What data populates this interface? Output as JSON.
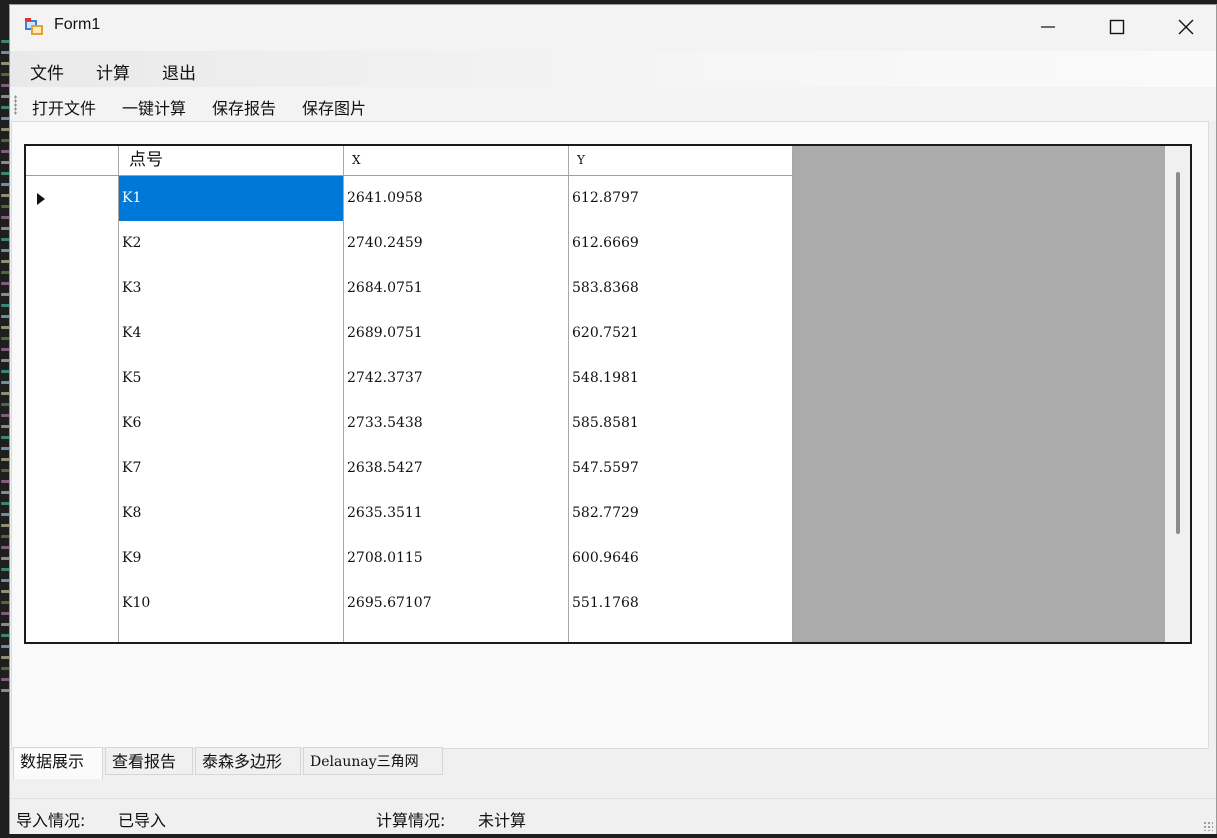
{
  "window": {
    "title": "Form1"
  },
  "menu": {
    "items": [
      "文件",
      "计算",
      "退出"
    ]
  },
  "toolbar": {
    "items": [
      "打开文件",
      "一键计算",
      "保存报告",
      "保存图片"
    ]
  },
  "grid": {
    "columns": [
      "点号",
      "X",
      "Y"
    ],
    "rows": [
      {
        "id": "K1",
        "x": "2641.0958",
        "y": "612.8797"
      },
      {
        "id": "K2",
        "x": "2740.2459",
        "y": "612.6669"
      },
      {
        "id": "K3",
        "x": "2684.0751",
        "y": "583.8368"
      },
      {
        "id": "K4",
        "x": "2689.0751",
        "y": "620.7521"
      },
      {
        "id": "K5",
        "x": "2742.3737",
        "y": "548.1981"
      },
      {
        "id": "K6",
        "x": "2733.5438",
        "y": "585.8581"
      },
      {
        "id": "K7",
        "x": "2638.5427",
        "y": "547.5597"
      },
      {
        "id": "K8",
        "x": "2635.3511",
        "y": "582.7729"
      },
      {
        "id": "K9",
        "x": "2708.0115",
        "y": "600.9646"
      },
      {
        "id": "K10",
        "x": "2695.67107",
        "y": "551.1768"
      }
    ],
    "selected_cell": "K1"
  },
  "tabs": {
    "items": [
      "数据展示",
      "查看报告",
      "泰森多边形",
      "Delaunay三角网"
    ],
    "active": "数据展示"
  },
  "status": {
    "import_label": "导入情况:",
    "import_value": "已导入",
    "calc_label": "计算情况:",
    "calc_value": "未计算"
  },
  "colors": {
    "selection": "#0078d7",
    "grid_empty_area": "#ababab"
  }
}
